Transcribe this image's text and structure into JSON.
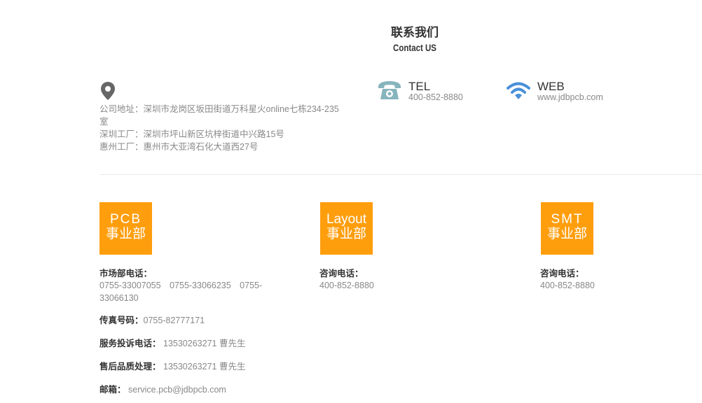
{
  "header": {
    "title_cn": "联系我们",
    "title_en": "Contact US"
  },
  "address": {
    "icon": "location-pin-icon",
    "lines": [
      "公司地址：深圳市龙岗区坂田街道万科星火online七栋234-235室",
      "深圳工厂：深圳市坪山新区坑梓街道中兴路15号",
      "惠州工厂：惠州市大亚湾石化大道西27号"
    ]
  },
  "tel": {
    "icon": "telephone-icon",
    "label": "TEL",
    "value": "400-852-8880"
  },
  "web": {
    "icon": "wifi-icon",
    "label": "WEB",
    "value": "www.jdbpcb.com"
  },
  "colors": {
    "badge": "#ff9e0d",
    "tel_icon": "#87b5bd",
    "wifi_icon": "#4a90d9",
    "pin_icon": "#666666"
  },
  "departments": {
    "pcb": {
      "badge_en": "PCB",
      "badge_cn": "事业部",
      "market_label": "市场部电话：",
      "market_value": "0755-33007055　0755-33066235　0755-33066130",
      "fax_label": "传真号码：",
      "fax_value": "0755-82777171",
      "complaint_label": "服务投诉电话：",
      "complaint_value": "13530263271 曹先生",
      "aftersales_label": "售后品质处理：",
      "aftersales_value": "13530263271 曹先生",
      "email_label": "邮箱：",
      "email_value": "service.pcb@jdbpcb.com"
    },
    "layout": {
      "badge_en": "Layout",
      "badge_cn": "事业部",
      "consult_label": "咨询电话：",
      "consult_value": "400-852-8880"
    },
    "smt": {
      "badge_en": "SMT",
      "badge_cn": "事业部",
      "consult_label": "咨询电话：",
      "consult_value": "400-852-8880"
    }
  }
}
